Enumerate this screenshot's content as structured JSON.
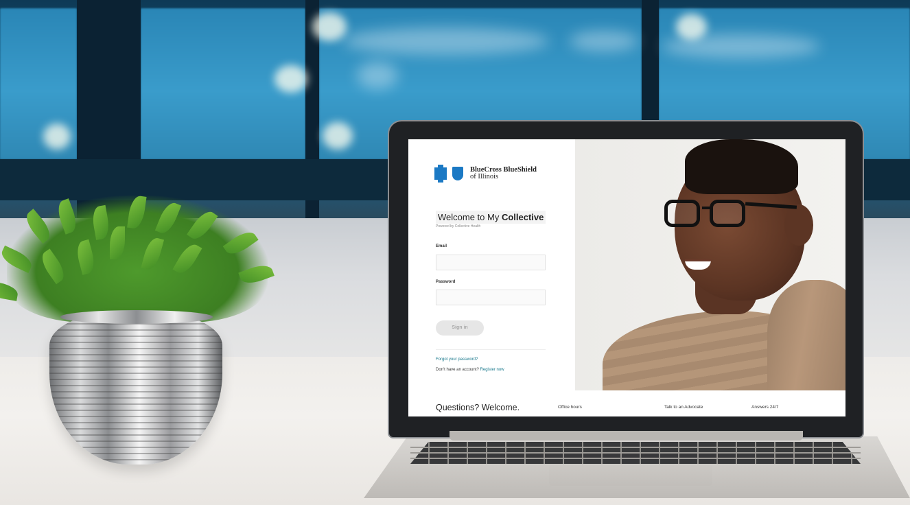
{
  "login": {
    "brand_line1": "BlueCross BlueShield",
    "brand_line2": "of Illinois",
    "welcome_prefix": "Welcome to My ",
    "welcome_bold": "Collective",
    "powered_by": "Powered by Collective Health",
    "email_label": "Email",
    "email_value": "",
    "password_label": "Password",
    "password_value": "",
    "signin_label": "Sign in",
    "forgot_link": "Forgot your password?",
    "no_account_text": "Don't have an account?",
    "register_link": "Register now"
  },
  "footer": {
    "heading": "Questions? Welcome.",
    "office_hours": "Office hours",
    "advocate": "Talk to an Advocate",
    "answers": "Answers 24/7"
  },
  "colors": {
    "brand_blue": "#1b79c4",
    "link_teal": "#15768a",
    "button_disabled_bg": "#e6e6e6"
  },
  "icons": [
    "bluecross-logo-icon",
    "blueshield-logo-icon"
  ]
}
